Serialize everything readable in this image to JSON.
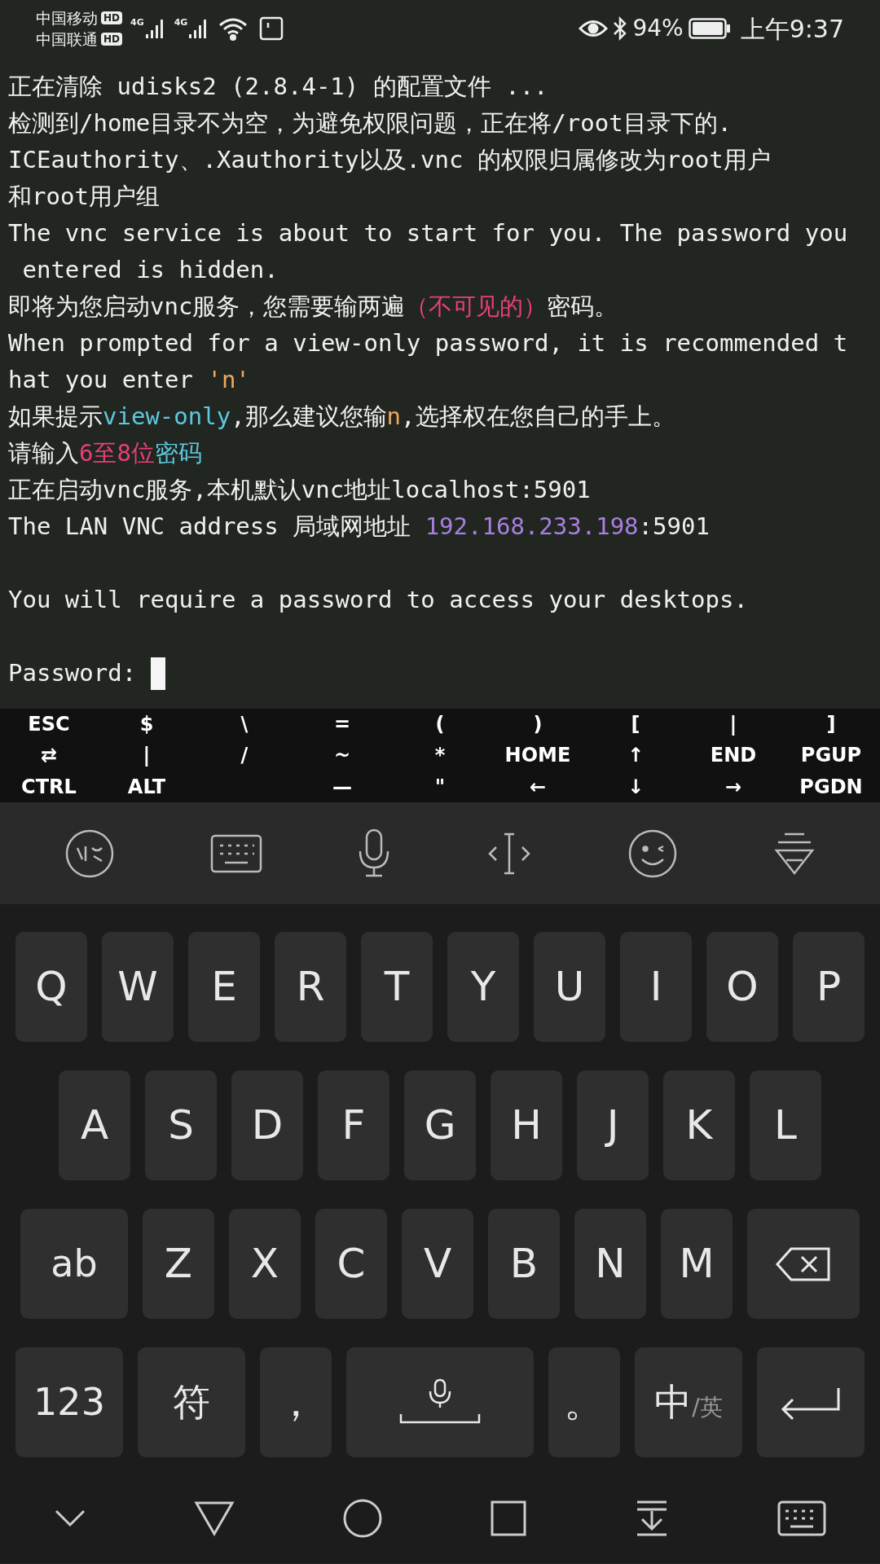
{
  "status_bar": {
    "carriers": [
      {
        "name": "中国移动",
        "badge": "HD"
      },
      {
        "name": "中国联通",
        "badge": "HD"
      }
    ],
    "signals": [
      {
        "network": "4G"
      },
      {
        "network": "4G"
      }
    ],
    "battery": "94%",
    "time": "上午9:37"
  },
  "terminal": {
    "lines": [
      {
        "kind": "text",
        "segments": [
          {
            "text": "正在清除 udisks2 (2.8.4-1) 的配置文件 ..."
          }
        ]
      },
      {
        "kind": "text",
        "segments": [
          {
            "text": "检测到/home目录不为空，为避免权限问题，正在将/root目录下的."
          }
        ]
      },
      {
        "kind": "text",
        "segments": [
          {
            "text": "ICEauthority、.Xauthority以及.vnc 的权限归属修改为root用户"
          }
        ]
      },
      {
        "kind": "text",
        "segments": [
          {
            "text": "和root用户组"
          }
        ]
      },
      {
        "kind": "text",
        "segments": [
          {
            "text": "The vnc service is about to start for you. The password you"
          }
        ]
      },
      {
        "kind": "text",
        "segments": [
          {
            "text": " entered is hidden."
          }
        ]
      },
      {
        "kind": "text",
        "segments": [
          {
            "text": "即将为您启动vnc服务，您需要输两遍"
          },
          {
            "text": "（不可见的）",
            "color": "#e8407a"
          },
          {
            "text": "密码。"
          }
        ]
      },
      {
        "kind": "text",
        "segments": [
          {
            "text": "When prompted for a view-only password, it is recommended t"
          }
        ]
      },
      {
        "kind": "text",
        "segments": [
          {
            "text": "hat you enter "
          },
          {
            "text": "'n'",
            "color": "#f0a860"
          }
        ]
      },
      {
        "kind": "text",
        "segments": [
          {
            "text": "如果提示"
          },
          {
            "text": "view-only",
            "color": "#5ec8e0"
          },
          {
            "text": ",那么建议您输"
          },
          {
            "text": "n",
            "color": "#f0a860"
          },
          {
            "text": ",选择权在您自己的手上。"
          }
        ]
      },
      {
        "kind": "text",
        "segments": [
          {
            "text": "请输入"
          },
          {
            "text": "6至8位",
            "color": "#e8407a"
          },
          {
            "text": "密码",
            "color": "#5ec8e0"
          }
        ]
      },
      {
        "kind": "text",
        "segments": [
          {
            "text": "正在启动vnc服务,本机默认vnc地址localhost:5901"
          }
        ]
      },
      {
        "kind": "text",
        "segments": [
          {
            "text": "The LAN VNC address 局域网地址 "
          },
          {
            "text": "192.168.233.198",
            "color": "#a87fe0"
          },
          {
            "text": ":5901"
          }
        ]
      },
      {
        "kind": "blank"
      },
      {
        "kind": "text",
        "segments": [
          {
            "text": "You will require a password to access your desktops."
          }
        ]
      },
      {
        "kind": "blank"
      }
    ],
    "prompt": "Password: ",
    "cursor": true
  },
  "extra_key_columns": [
    [
      "ESC",
      "⇄",
      "CTRL"
    ],
    [
      "$",
      "|",
      "ALT"
    ],
    [
      "\\",
      "/"
    ],
    [
      "=",
      "~",
      "—"
    ],
    [
      "(",
      "*",
      "\""
    ],
    [
      ")",
      "HOME",
      "←"
    ],
    [
      "[",
      "↑",
      "↓"
    ],
    [
      "|",
      "END",
      "→"
    ],
    [
      "]",
      "PGUP",
      "PGDN"
    ]
  ],
  "keyboard": {
    "key_rows": [
      {
        "keys": [
          {
            "kind": "letter",
            "label": "Q"
          },
          {
            "kind": "letter",
            "label": "W"
          },
          {
            "kind": "letter",
            "label": "E"
          },
          {
            "kind": "letter",
            "label": "R"
          },
          {
            "kind": "letter",
            "label": "T"
          },
          {
            "kind": "letter",
            "label": "Y"
          },
          {
            "kind": "letter",
            "label": "U"
          },
          {
            "kind": "letter",
            "label": "I"
          },
          {
            "kind": "letter",
            "label": "O"
          },
          {
            "kind": "letter",
            "label": "P"
          }
        ]
      },
      {
        "keys": [
          {
            "kind": "letter",
            "label": "A"
          },
          {
            "kind": "letter",
            "label": "S"
          },
          {
            "kind": "letter",
            "label": "D"
          },
          {
            "kind": "letter",
            "label": "F"
          },
          {
            "kind": "letter",
            "label": "G"
          },
          {
            "kind": "letter",
            "label": "H"
          },
          {
            "kind": "letter",
            "label": "J"
          },
          {
            "kind": "letter",
            "label": "K"
          },
          {
            "kind": "letter",
            "label": "L"
          }
        ]
      },
      {
        "keys": [
          {
            "kind": "wide",
            "label": "ab"
          },
          {
            "kind": "letter",
            "label": "Z"
          },
          {
            "kind": "letter",
            "label": "X"
          },
          {
            "kind": "letter",
            "label": "C"
          },
          {
            "kind": "letter",
            "label": "V"
          },
          {
            "kind": "letter",
            "label": "B"
          },
          {
            "kind": "letter",
            "label": "N"
          },
          {
            "kind": "letter",
            "label": "M"
          },
          {
            "kind": "backspace"
          }
        ]
      },
      {
        "keys": [
          {
            "kind": "wide",
            "label": "123"
          },
          {
            "kind": "wide",
            "label": "符"
          },
          {
            "kind": "letter",
            "label": "，"
          },
          {
            "kind": "space"
          },
          {
            "kind": "letter",
            "label": "。"
          },
          {
            "kind": "lang",
            "label": "中",
            "sub": "/英"
          },
          {
            "kind": "enter"
          }
        ]
      }
    ]
  }
}
